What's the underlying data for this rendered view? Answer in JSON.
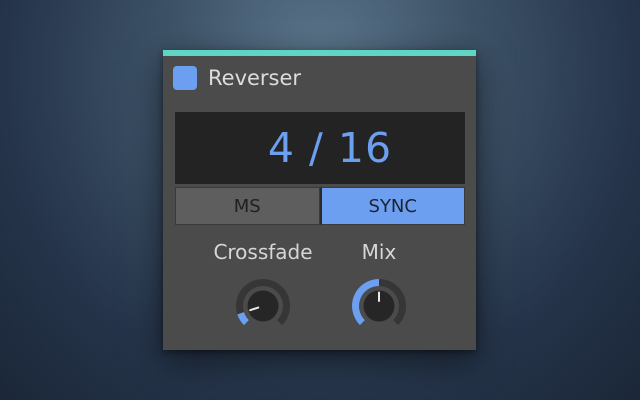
{
  "device": {
    "title": "Reverser",
    "enabled": true
  },
  "display": {
    "value": "4 / 16"
  },
  "mode": {
    "options": [
      "MS",
      "SYNC"
    ],
    "selected": "SYNC"
  },
  "knobs": [
    {
      "label": "Crossfade",
      "value_fraction": 0.1
    },
    {
      "label": "Mix",
      "value_fraction": 0.5
    }
  ],
  "colors": {
    "accent_bar": "#5fd6c3",
    "active_blue": "#6c9ff0",
    "panel": "#4b4b4b",
    "display_bg": "#232323",
    "knob_track": "#363636",
    "knob_body": "#262626"
  }
}
